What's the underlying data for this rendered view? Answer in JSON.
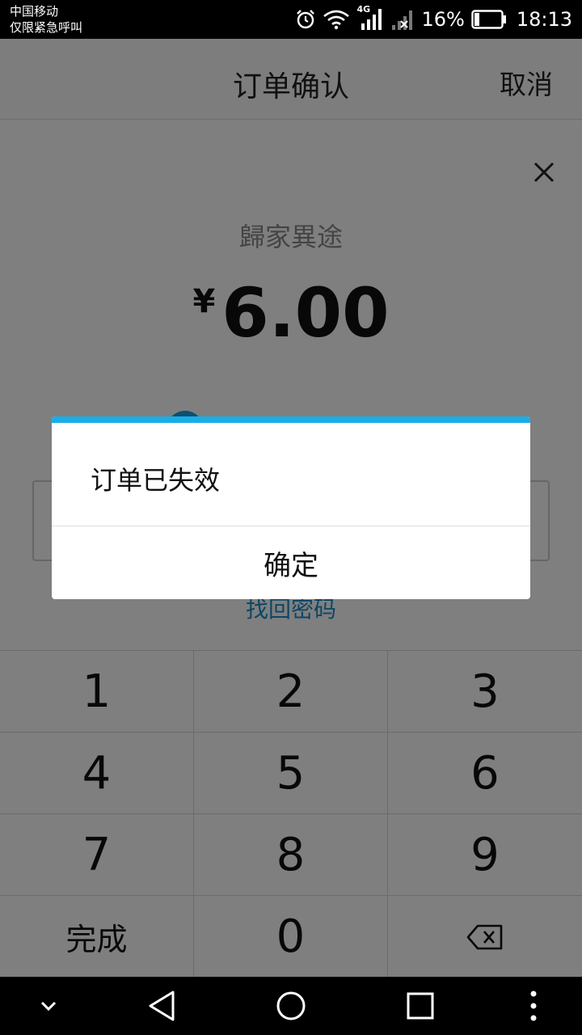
{
  "status_bar": {
    "carrier_line1": "中国移动",
    "carrier_line2": "仅限紧急呼叫",
    "network": "4G",
    "battery": "16%",
    "time": "18:13",
    "icons": [
      "alarm-icon",
      "wifi-icon",
      "signal-4g-icon",
      "signal-no-sim-icon",
      "battery-icon"
    ]
  },
  "header": {
    "title": "订单确认",
    "cancel_label": "取消"
  },
  "payment": {
    "merchant": "歸家異途",
    "currency_symbol": "¥",
    "amount": "6.00",
    "forgot_password": "找回密码"
  },
  "keypad": {
    "keys": [
      "1",
      "2",
      "3",
      "4",
      "5",
      "6",
      "7",
      "8",
      "9",
      "完成",
      "0"
    ],
    "delete_icon": "backspace-icon"
  },
  "dialog": {
    "message": "订单已失效",
    "ok_label": "确定"
  },
  "nav_bar": {
    "icons": [
      "chevron-down-icon",
      "back-icon",
      "home-icon",
      "recents-icon",
      "more-icon"
    ]
  },
  "colors": {
    "accent": "#1aaee6",
    "link": "#1a8cc8",
    "overlay": "rgba(0,0,0,0.5)"
  }
}
